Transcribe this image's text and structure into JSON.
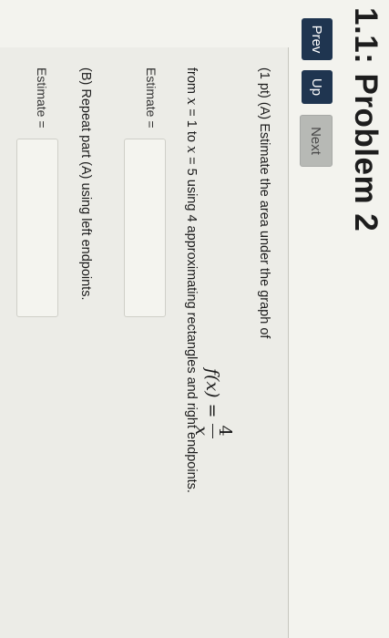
{
  "header": {
    "title": "1.1: Problem 2",
    "prev_label": "Prev",
    "up_label": "Up",
    "next_label": "Next"
  },
  "problem": {
    "intro": "(1 pt) (A) Estimate the area under the graph of",
    "function_lhs": "f(x) =",
    "function_numerator": "4",
    "function_denominator": "x",
    "range_from_text": "from",
    "range_var1": "x",
    "range_eq1": " = 1 to ",
    "range_var2": "x",
    "range_eq2": " = 5 using 4 approximating rectangles and right endpoints.",
    "estimate_a_label": "Estimate =",
    "estimate_a_value": "",
    "part_b": "(B) Repeat part (A) using left endpoints.",
    "estimate_b_label": "Estimate =",
    "estimate_b_value": ""
  }
}
